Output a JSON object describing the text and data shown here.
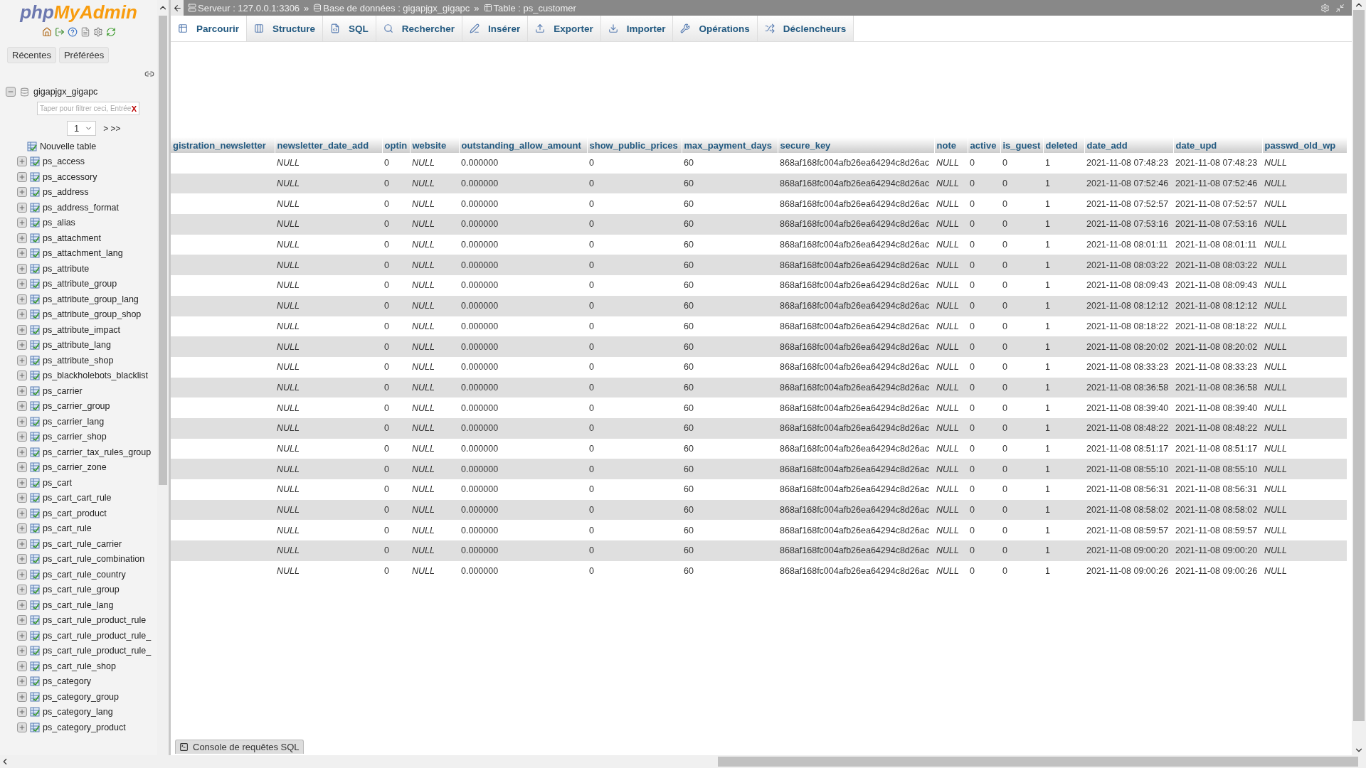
{
  "sidebar": {
    "logo": {
      "part1": "php",
      "part2": "MyAdmin"
    },
    "buttons": [
      "Récentes",
      "Préférées"
    ],
    "database": {
      "name": "gigapjgx_gigapc",
      "expanded": true
    },
    "filter": {
      "placeholder": "Taper pour filtrer ceci, Entrée",
      "clear": "X"
    },
    "pager": {
      "page": "1",
      "next": "> >>"
    },
    "new_table": "Nouvelle table",
    "tables": [
      "ps_access",
      "ps_accessory",
      "ps_address",
      "ps_address_format",
      "ps_alias",
      "ps_attachment",
      "ps_attachment_lang",
      "ps_attribute",
      "ps_attribute_group",
      "ps_attribute_group_lang",
      "ps_attribute_group_shop",
      "ps_attribute_impact",
      "ps_attribute_lang",
      "ps_attribute_shop",
      "ps_blackholebots_blacklist",
      "ps_carrier",
      "ps_carrier_group",
      "ps_carrier_lang",
      "ps_carrier_shop",
      "ps_carrier_tax_rules_group",
      "ps_carrier_zone",
      "ps_cart",
      "ps_cart_cart_rule",
      "ps_cart_product",
      "ps_cart_rule",
      "ps_cart_rule_carrier",
      "ps_cart_rule_combination",
      "ps_cart_rule_country",
      "ps_cart_rule_group",
      "ps_cart_rule_lang",
      "ps_cart_rule_product_rule",
      "ps_cart_rule_product_rule_",
      "ps_cart_rule_product_rule_",
      "ps_cart_rule_shop",
      "ps_category",
      "ps_category_group",
      "ps_category_lang",
      "ps_category_product"
    ]
  },
  "breadcrumb": [
    {
      "kind": "server",
      "label": "Serveur : 127.0.0.1:3306"
    },
    {
      "kind": "separator",
      "label": "»"
    },
    {
      "kind": "database",
      "label": "Base de données : gigapjgx_gigapc"
    },
    {
      "kind": "separator",
      "label": "»"
    },
    {
      "kind": "table",
      "label": "Table : ps_customer"
    }
  ],
  "tabs": [
    {
      "label": "Parcourir",
      "selected": true
    },
    {
      "label": "Structure",
      "selected": false
    },
    {
      "label": "SQL",
      "selected": false
    },
    {
      "label": "Rechercher",
      "selected": false
    },
    {
      "label": "Insérer",
      "selected": false
    },
    {
      "label": "Exporter",
      "selected": false
    },
    {
      "label": "Importer",
      "selected": false
    },
    {
      "label": "Opérations",
      "selected": false
    },
    {
      "label": "Déclencheurs",
      "selected": false
    }
  ],
  "table": {
    "columns": [
      {
        "label": "gistration_newsletter"
      },
      {
        "label": "newsletter_date_add",
        "kind": "null"
      },
      {
        "label": "optin",
        "kind": "text"
      },
      {
        "label": "website",
        "kind": "null"
      },
      {
        "label": "outstanding_allow_amount",
        "kind": "text"
      },
      {
        "label": "show_public_prices",
        "kind": "text"
      },
      {
        "label": "max_payment_days",
        "kind": "text"
      },
      {
        "label": "secure_key",
        "kind": "text"
      },
      {
        "label": "note",
        "kind": "null"
      },
      {
        "label": "active",
        "kind": "text"
      },
      {
        "label": "is_guest",
        "kind": "text"
      },
      {
        "label": "deleted",
        "kind": "text"
      },
      {
        "label": "date_add",
        "kind": "text"
      },
      {
        "label": "date_upd",
        "kind": "text"
      },
      {
        "label": "passwd_old_wp",
        "kind": "null"
      }
    ],
    "rows": [
      [
        "",
        "NULL",
        "0",
        "NULL",
        "0.000000",
        "0",
        "60",
        "868af168fc004afb26ea64294c8d26ac",
        "NULL",
        "0",
        "0",
        "1",
        "2021-11-08 07:48:23",
        "2021-11-08 07:48:23",
        "NULL"
      ],
      [
        "",
        "NULL",
        "0",
        "NULL",
        "0.000000",
        "0",
        "60",
        "868af168fc004afb26ea64294c8d26ac",
        "NULL",
        "0",
        "0",
        "1",
        "2021-11-08 07:52:46",
        "2021-11-08 07:52:46",
        "NULL"
      ],
      [
        "",
        "NULL",
        "0",
        "NULL",
        "0.000000",
        "0",
        "60",
        "868af168fc004afb26ea64294c8d26ac",
        "NULL",
        "0",
        "0",
        "1",
        "2021-11-08 07:52:57",
        "2021-11-08 07:52:57",
        "NULL"
      ],
      [
        "",
        "NULL",
        "0",
        "NULL",
        "0.000000",
        "0",
        "60",
        "868af168fc004afb26ea64294c8d26ac",
        "NULL",
        "0",
        "0",
        "1",
        "2021-11-08 07:53:16",
        "2021-11-08 07:53:16",
        "NULL"
      ],
      [
        "",
        "NULL",
        "0",
        "NULL",
        "0.000000",
        "0",
        "60",
        "868af168fc004afb26ea64294c8d26ac",
        "NULL",
        "0",
        "0",
        "1",
        "2021-11-08 08:01:11",
        "2021-11-08 08:01:11",
        "NULL"
      ],
      [
        "",
        "NULL",
        "0",
        "NULL",
        "0.000000",
        "0",
        "60",
        "868af168fc004afb26ea64294c8d26ac",
        "NULL",
        "0",
        "0",
        "1",
        "2021-11-08 08:03:22",
        "2021-11-08 08:03:22",
        "NULL"
      ],
      [
        "",
        "NULL",
        "0",
        "NULL",
        "0.000000",
        "0",
        "60",
        "868af168fc004afb26ea64294c8d26ac",
        "NULL",
        "0",
        "0",
        "1",
        "2021-11-08 08:09:43",
        "2021-11-08 08:09:43",
        "NULL"
      ],
      [
        "",
        "NULL",
        "0",
        "NULL",
        "0.000000",
        "0",
        "60",
        "868af168fc004afb26ea64294c8d26ac",
        "NULL",
        "0",
        "0",
        "1",
        "2021-11-08 08:12:12",
        "2021-11-08 08:12:12",
        "NULL"
      ],
      [
        "",
        "NULL",
        "0",
        "NULL",
        "0.000000",
        "0",
        "60",
        "868af168fc004afb26ea64294c8d26ac",
        "NULL",
        "0",
        "0",
        "1",
        "2021-11-08 08:18:22",
        "2021-11-08 08:18:22",
        "NULL"
      ],
      [
        "",
        "NULL",
        "0",
        "NULL",
        "0.000000",
        "0",
        "60",
        "868af168fc004afb26ea64294c8d26ac",
        "NULL",
        "0",
        "0",
        "1",
        "2021-11-08 08:20:02",
        "2021-11-08 08:20:02",
        "NULL"
      ],
      [
        "",
        "NULL",
        "0",
        "NULL",
        "0.000000",
        "0",
        "60",
        "868af168fc004afb26ea64294c8d26ac",
        "NULL",
        "0",
        "0",
        "1",
        "2021-11-08 08:33:23",
        "2021-11-08 08:33:23",
        "NULL"
      ],
      [
        "",
        "NULL",
        "0",
        "NULL",
        "0.000000",
        "0",
        "60",
        "868af168fc004afb26ea64294c8d26ac",
        "NULL",
        "0",
        "0",
        "1",
        "2021-11-08 08:36:58",
        "2021-11-08 08:36:58",
        "NULL"
      ],
      [
        "",
        "NULL",
        "0",
        "NULL",
        "0.000000",
        "0",
        "60",
        "868af168fc004afb26ea64294c8d26ac",
        "NULL",
        "0",
        "0",
        "1",
        "2021-11-08 08:39:40",
        "2021-11-08 08:39:40",
        "NULL"
      ],
      [
        "",
        "NULL",
        "0",
        "NULL",
        "0.000000",
        "0",
        "60",
        "868af168fc004afb26ea64294c8d26ac",
        "NULL",
        "0",
        "0",
        "1",
        "2021-11-08 08:48:22",
        "2021-11-08 08:48:22",
        "NULL"
      ],
      [
        "",
        "NULL",
        "0",
        "NULL",
        "0.000000",
        "0",
        "60",
        "868af168fc004afb26ea64294c8d26ac",
        "NULL",
        "0",
        "0",
        "1",
        "2021-11-08 08:51:17",
        "2021-11-08 08:51:17",
        "NULL"
      ],
      [
        "",
        "NULL",
        "0",
        "NULL",
        "0.000000",
        "0",
        "60",
        "868af168fc004afb26ea64294c8d26ac",
        "NULL",
        "0",
        "0",
        "1",
        "2021-11-08 08:55:10",
        "2021-11-08 08:55:10",
        "NULL"
      ],
      [
        "",
        "NULL",
        "0",
        "NULL",
        "0.000000",
        "0",
        "60",
        "868af168fc004afb26ea64294c8d26ac",
        "NULL",
        "0",
        "0",
        "1",
        "2021-11-08 08:56:31",
        "2021-11-08 08:56:31",
        "NULL"
      ],
      [
        "",
        "NULL",
        "0",
        "NULL",
        "0.000000",
        "0",
        "60",
        "868af168fc004afb26ea64294c8d26ac",
        "NULL",
        "0",
        "0",
        "1",
        "2021-11-08 08:58:02",
        "2021-11-08 08:58:02",
        "NULL"
      ],
      [
        "",
        "NULL",
        "0",
        "NULL",
        "0.000000",
        "0",
        "60",
        "868af168fc004afb26ea64294c8d26ac",
        "NULL",
        "0",
        "0",
        "1",
        "2021-11-08 08:59:57",
        "2021-11-08 08:59:57",
        "NULL"
      ],
      [
        "",
        "NULL",
        "0",
        "NULL",
        "0.000000",
        "0",
        "60",
        "868af168fc004afb26ea64294c8d26ac",
        "NULL",
        "0",
        "0",
        "1",
        "2021-11-08 09:00:20",
        "2021-11-08 09:00:20",
        "NULL"
      ],
      [
        "",
        "NULL",
        "0",
        "NULL",
        "0.000000",
        "0",
        "60",
        "868af168fc004afb26ea64294c8d26ac",
        "NULL",
        "0",
        "0",
        "1",
        "2021-11-08 09:00:26",
        "2021-11-08 09:00:26",
        "NULL"
      ]
    ]
  },
  "console": {
    "label": "Console de requêtes SQL"
  }
}
